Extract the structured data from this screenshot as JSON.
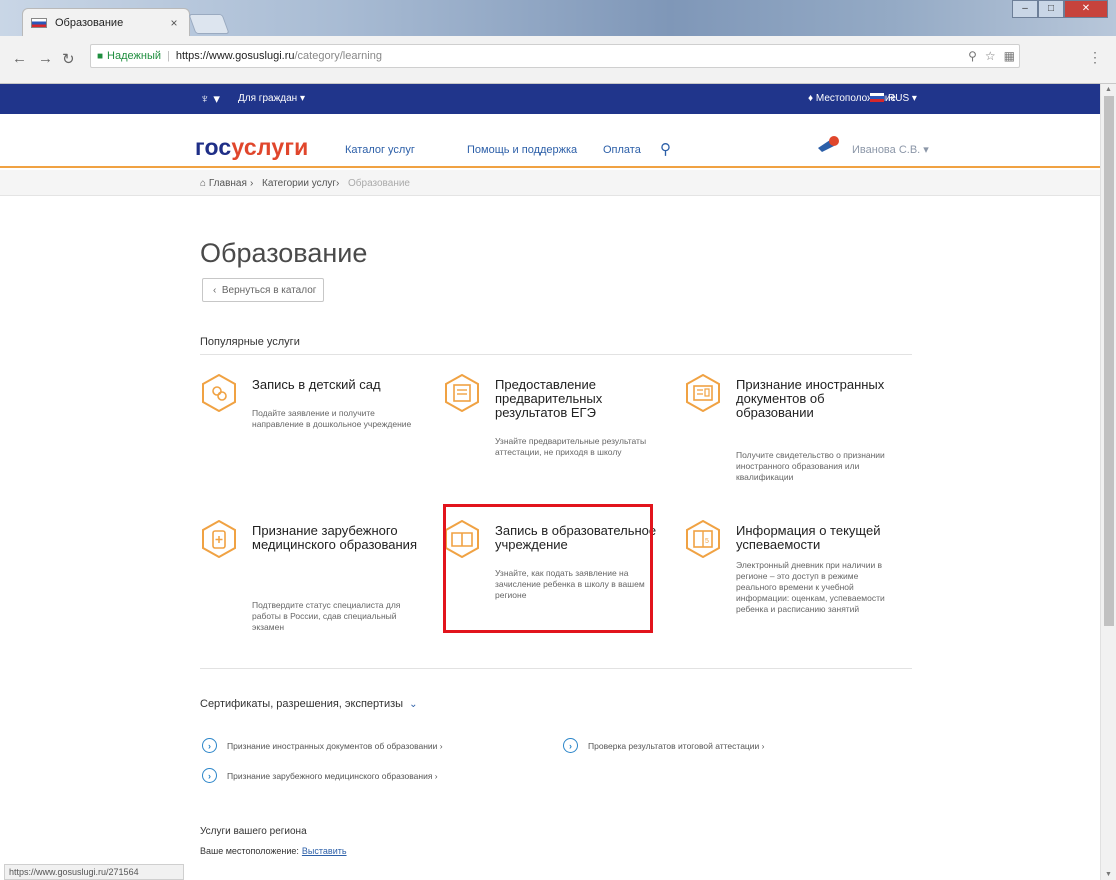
{
  "browser": {
    "tab_title": "Образование",
    "tab_close": "×",
    "secure_label": "Надежный",
    "url_host": "https://www.gosuslugi.ru",
    "url_path": "/category/learning",
    "status_url": "https://www.gosuslugi.ru/271564"
  },
  "topbar": {
    "audience": "Для граждан",
    "location": "Местоположение",
    "language": "RUS"
  },
  "header": {
    "logo_part1": "гос",
    "logo_part2": "услуги",
    "nav": [
      "Каталог услуг",
      "Помощь и поддержка",
      "Оплата"
    ],
    "user_name": "Иванова С.В."
  },
  "breadcrumb": [
    "Главная",
    "Категории услуг",
    "Образование"
  ],
  "page": {
    "title": "Образование",
    "back_label": "Вернуться в каталог",
    "popular_label": "Популярные услуги"
  },
  "services": [
    {
      "title": "Запись в детский сад",
      "desc": "Подайте заявление и получите направление в дошкольное учреждение"
    },
    {
      "title": "Предоставление предварительных результатов ЕГЭ",
      "desc": "Узнайте предварительные результаты аттестации, не приходя в школу"
    },
    {
      "title": "Признание иностранных документов об образовании",
      "desc": "Получите свидетельство о признании иностранного образования или квалификации"
    },
    {
      "title": "Признание зарубежного медицинского образования",
      "desc": "Подтвердите статус специалиста для работы в России, сдав специальный экзамен"
    },
    {
      "title": "Запись в образовательное учреждение",
      "desc": "Узнайте, как подать заявление на зачисление ребенка в школу в вашем регионе"
    },
    {
      "title": "Информация о текущей успеваемости",
      "desc": "Электронный дневник при наличии в регионе – это доступ в режиме реального времени к учебной информации: оценкам, успеваемости ребенка и расписанию занятий"
    }
  ],
  "certificates": {
    "header": "Сертификаты, разрешения, экспертизы",
    "items": [
      "Признание иностранных документов об образовании",
      "Проверка результатов итоговой аттестации",
      "Признание зарубежного медицинского образования"
    ]
  },
  "region": {
    "title": "Услуги вашего региона",
    "location_label": "Ваше местоположение:",
    "location_link": "Выставить"
  },
  "colors": {
    "topbar": "#20358b",
    "accent_orange": "#f0a243",
    "highlight_red": "#e2141c",
    "logo_blue": "#1f2f87",
    "logo_red": "#e0462c"
  }
}
